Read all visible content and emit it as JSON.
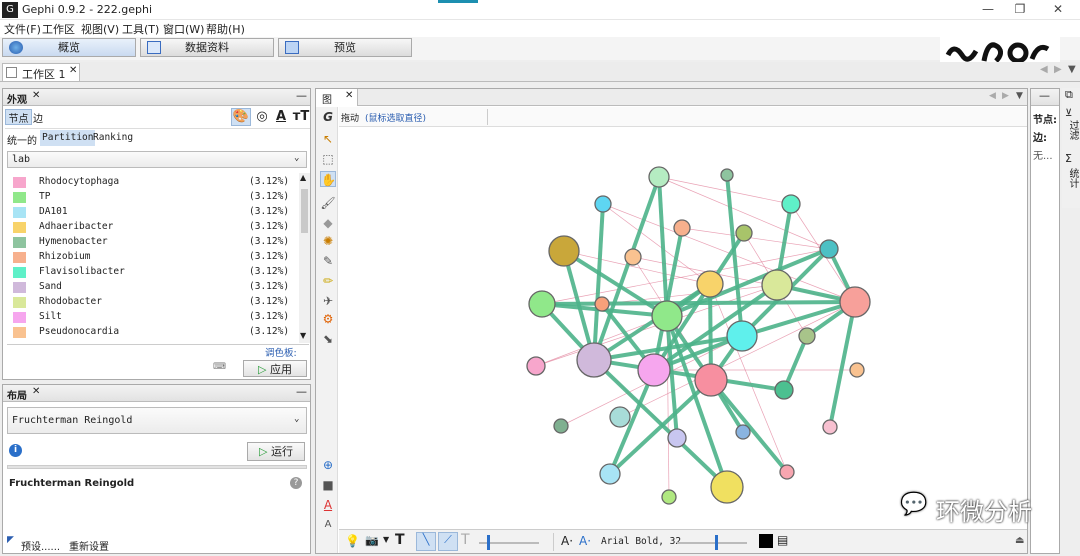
{
  "window": {
    "title": "Gephi 0.9.2 - 222.gephi",
    "app_icon": "G",
    "minimize": "—",
    "maximize": "❐",
    "close": "✕"
  },
  "menu": [
    "文件(F)",
    "工作区",
    "视图(V)",
    "工具(T)",
    "窗口(W)",
    "帮助(H)"
  ],
  "modes": [
    {
      "label": "概览"
    },
    {
      "label": "数据资料"
    },
    {
      "label": "预览"
    }
  ],
  "workspace_tab": "工作区 1",
  "appearance": {
    "title": "外观",
    "tabs": [
      "节点",
      "边"
    ],
    "subtabs": [
      "统一的",
      "Partition",
      "Ranking"
    ],
    "attribute": "lab",
    "items": [
      {
        "name": "Rhodocytophaga",
        "pct": "(3.12%)",
        "color": "#f7a6cc"
      },
      {
        "name": "TP",
        "pct": "(3.12%)",
        "color": "#90e88a"
      },
      {
        "name": "DA101",
        "pct": "(3.12%)",
        "color": "#a8e4f5"
      },
      {
        "name": "Adhaeribacter",
        "pct": "(3.12%)",
        "color": "#f8d36a"
      },
      {
        "name": "Hymenobacter",
        "pct": "(3.12%)",
        "color": "#8ec49f"
      },
      {
        "name": "Rhizobium",
        "pct": "(3.12%)",
        "color": "#f7b08d"
      },
      {
        "name": "Flavisolibacter",
        "pct": "(3.12%)",
        "color": "#5ff0c8"
      },
      {
        "name": "Sand",
        "pct": "(3.12%)",
        "color": "#d0b9db"
      },
      {
        "name": "Rhodobacter",
        "pct": "(3.12%)",
        "color": "#d9e89a"
      },
      {
        "name": "Silt",
        "pct": "(3.12%)",
        "color": "#f6a6ee"
      },
      {
        "name": "Pseudonocardia",
        "pct": "(3.12%)",
        "color": "#f9c290"
      }
    ],
    "palette_link": "调色板:",
    "apply": "应用"
  },
  "layout": {
    "title": "布局",
    "algorithm": "Fruchterman Reingold",
    "run": "运行",
    "heading": "Fruchterman Reingold",
    "presets": "预设......",
    "reset": "重新设置"
  },
  "graph": {
    "tab": "图",
    "drag_label": "拖动",
    "hint": "(鼠标选取直径)",
    "font_label": "Arial Bold, 32"
  },
  "context": {
    "nodes": "节点:",
    "edges": "边:",
    "none": "无..."
  },
  "side_tabs": [
    "过滤",
    "统计"
  ],
  "watermark": "环微分析",
  "colors": {
    "edge": "#4db389",
    "thin_edge": "#e07b95",
    "accent": "#2a5db0"
  }
}
